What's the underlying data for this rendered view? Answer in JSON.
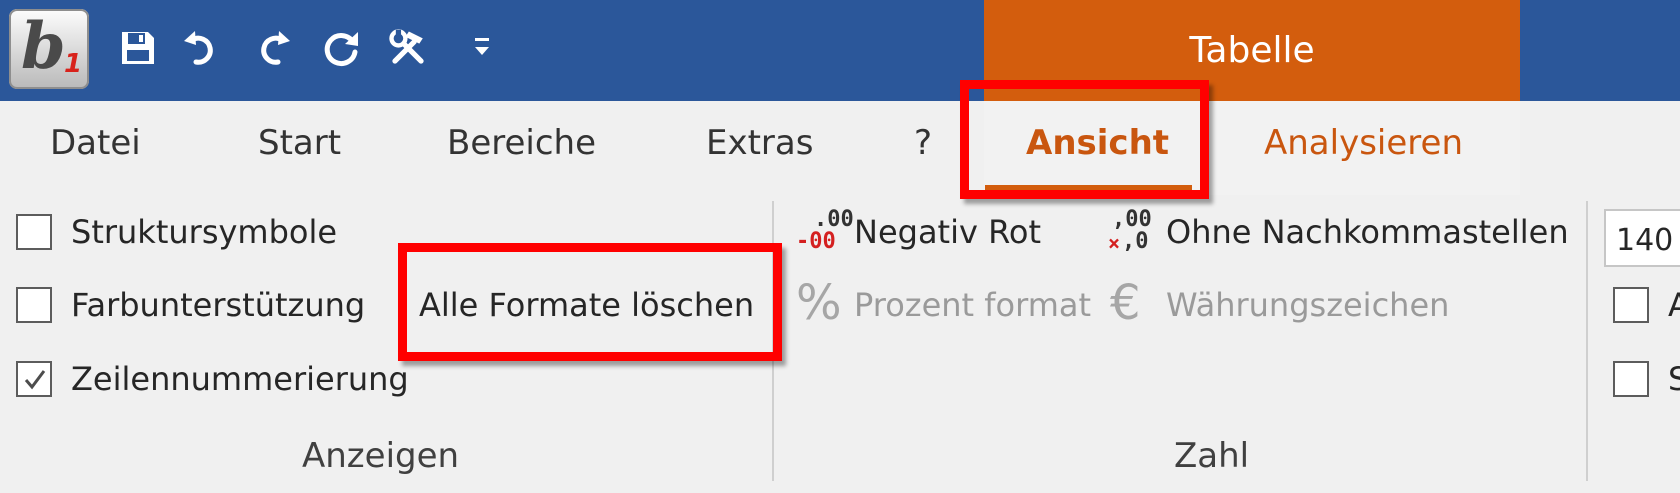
{
  "title_bar": {
    "logo_icon": "b1-logo-icon",
    "quick_access": [
      "save-icon",
      "undo-icon",
      "redo-icon",
      "refresh-icon",
      "tools-icon",
      "customize-dropdown-icon"
    ],
    "context_tab_title": "Tabelle",
    "colors": {
      "bar": "#2b579a",
      "context": "#d35d0d"
    }
  },
  "tabs": {
    "datei": "Datei",
    "start": "Start",
    "bereiche": "Bereiche",
    "extras": "Extras",
    "help": "?",
    "ansicht": "Ansicht",
    "analysieren": "Analysieren",
    "active": "Ansicht"
  },
  "anzeigen": {
    "label": "Anzeigen",
    "struktursymbole": {
      "label": "Struktursymbole",
      "checked": false
    },
    "farbunterstuetzung": {
      "label": "Farbunterstützung",
      "checked": false
    },
    "zeilennummerierung": {
      "label": "Zeilennummerierung",
      "checked": true
    },
    "alle_formate_loeschen": "Alle Formate löschen"
  },
  "zahl": {
    "label": "Zahl",
    "negativ_rot": {
      "label": "Negativ Rot",
      "icon": "negative-red-icon",
      "icon_top": ".00",
      "icon_bottom": "-00"
    },
    "ohne_nachkommastellen": {
      "label": "Ohne Nachkommastellen",
      "icon": "decrease-decimal-icon",
      "icon_top": ",00",
      "icon_bottom": ",0"
    },
    "prozent_format": {
      "label": "Prozent format",
      "icon": "percent-icon",
      "icon_glyph": "%",
      "enabled": false
    },
    "waehrungszeichen": {
      "label": "Währungszeichen",
      "icon": "euro-icon",
      "icon_glyph": "€",
      "enabled": false
    }
  },
  "third_group": {
    "zoom_value": "140",
    "cb1_partial": "A",
    "cb2_partial": "S"
  }
}
